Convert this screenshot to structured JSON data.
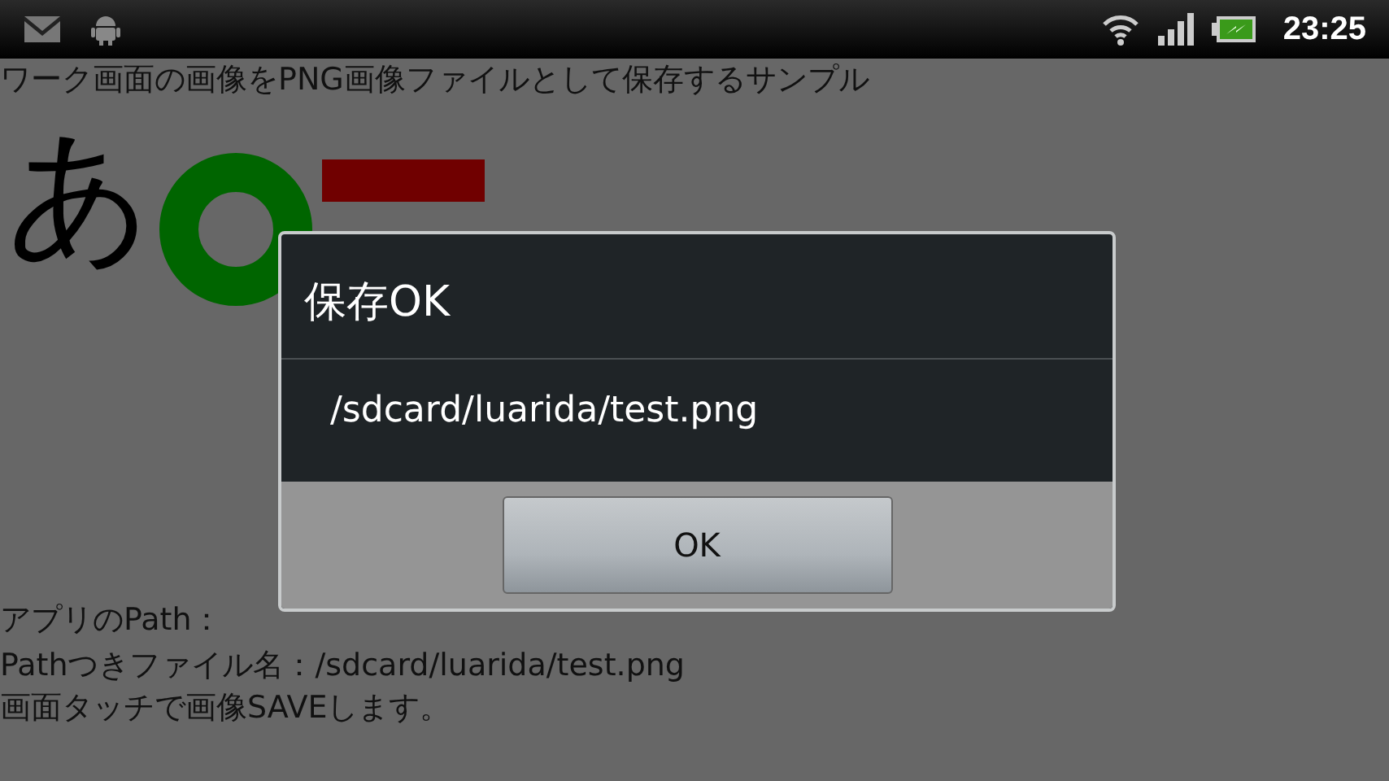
{
  "status_bar": {
    "time": "23:25"
  },
  "page": {
    "title": "ワーク画面の画像をPNG画像ファイルとして保存するサンプル",
    "glyph": "あ",
    "lines": [
      "アプリのPath：",
      "Pathつきファイル名：/sdcard/luarida/test.png",
      "画面タッチで画像SAVEします。"
    ]
  },
  "dialog": {
    "title": "保存OK",
    "message": "/sdcard/luarida/test.png",
    "buttons": [
      "OK"
    ]
  }
}
